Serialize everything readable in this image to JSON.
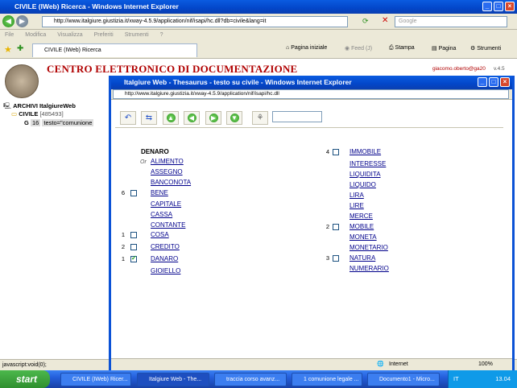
{
  "outer": {
    "title": "CIVILE (IWeb) Ricerca - Windows Internet Explorer",
    "url": "http://www.italgiure.giustizia.it/xway-4.5.9/application/nif/isapi/hc.dll?db=civile&lang=it",
    "search_placeholder": "Google",
    "menu": [
      "File",
      "Modifica",
      "Visualizza",
      "Preferiti",
      "Strumenti",
      "?"
    ],
    "tab_label": "CIVILE (IWeb) Ricerca",
    "commands": [
      "Pagina iniziale",
      "Feed (J)",
      "Stampa",
      "Pagina",
      "Strumenti"
    ],
    "header_title": "CENTRO ELETTRONICO DI DOCUMENTAZIONE",
    "user": "giacomo.oberto@ga20",
    "version": "v.4.5",
    "tree": {
      "root": "ARCHIVI ItalgiureWeb",
      "archive": "CIVILE",
      "archive_count": "[485493]",
      "query_g": "G",
      "query_count": "16",
      "query_text": "testo=\"comunione"
    },
    "status": "javascript:void(0);"
  },
  "inner": {
    "title": "Italgiure Web - Thesaurus - testo su civile - Windows Internet Explorer",
    "url": "http://www.italgiure.giustizia.it/xway-4.5.9/application/nif/isapi/hc.dll",
    "heading": "DENARO",
    "or_label": "Or",
    "status_zone": "Internet",
    "zoom": "100%",
    "left_terms": [
      {
        "count": "",
        "checkbox": false,
        "checked": false,
        "term": "ALIMENTO"
      },
      {
        "count": "",
        "checkbox": false,
        "checked": false,
        "term": "ASSEGNO"
      },
      {
        "count": "",
        "checkbox": false,
        "checked": false,
        "term": "BANCONOTA"
      },
      {
        "count": "6",
        "checkbox": true,
        "checked": false,
        "term": "BENE"
      },
      {
        "count": "",
        "checkbox": false,
        "checked": false,
        "term": "CAPITALE"
      },
      {
        "count": "",
        "checkbox": false,
        "checked": false,
        "term": "CASSA"
      },
      {
        "count": "",
        "checkbox": false,
        "checked": false,
        "term": "CONTANTE"
      },
      {
        "count": "1",
        "checkbox": true,
        "checked": false,
        "term": "COSA"
      },
      {
        "count": "2",
        "checkbox": true,
        "checked": false,
        "term": "CREDITO"
      },
      {
        "count": "1",
        "checkbox": true,
        "checked": true,
        "term": "DANARO"
      },
      {
        "count": "",
        "checkbox": false,
        "checked": false,
        "term": "GIOIELLO"
      }
    ],
    "right_terms": [
      {
        "count": "4",
        "checkbox": true,
        "checked": false,
        "term": "IMMOBILE"
      },
      {
        "count": "",
        "checkbox": false,
        "checked": false,
        "term": "INTERESSE"
      },
      {
        "count": "",
        "checkbox": false,
        "checked": false,
        "term": "LIQUIDITA"
      },
      {
        "count": "",
        "checkbox": false,
        "checked": false,
        "term": "LIQUIDO"
      },
      {
        "count": "",
        "checkbox": false,
        "checked": false,
        "term": "LIRA"
      },
      {
        "count": "",
        "checkbox": false,
        "checked": false,
        "term": "LIRE"
      },
      {
        "count": "",
        "checkbox": false,
        "checked": false,
        "term": "MERCE"
      },
      {
        "count": "2",
        "checkbox": true,
        "checked": false,
        "term": "MOBILE"
      },
      {
        "count": "",
        "checkbox": false,
        "checked": false,
        "term": "MONETA"
      },
      {
        "count": "",
        "checkbox": false,
        "checked": false,
        "term": "MONETARIO"
      },
      {
        "count": "3",
        "checkbox": true,
        "checked": false,
        "term": "NATURA"
      },
      {
        "count": "",
        "checkbox": false,
        "checked": false,
        "term": "NUMERARIO"
      }
    ]
  },
  "taskbar": {
    "start": "start",
    "tasks": [
      "CIVILE (IWeb) Ricer...",
      "Italgiure Web - The...",
      "traccia corso avanz...",
      "1 comunione legale ...",
      "Documento1 - Micro..."
    ],
    "lang": "IT",
    "clock": "13.04"
  }
}
